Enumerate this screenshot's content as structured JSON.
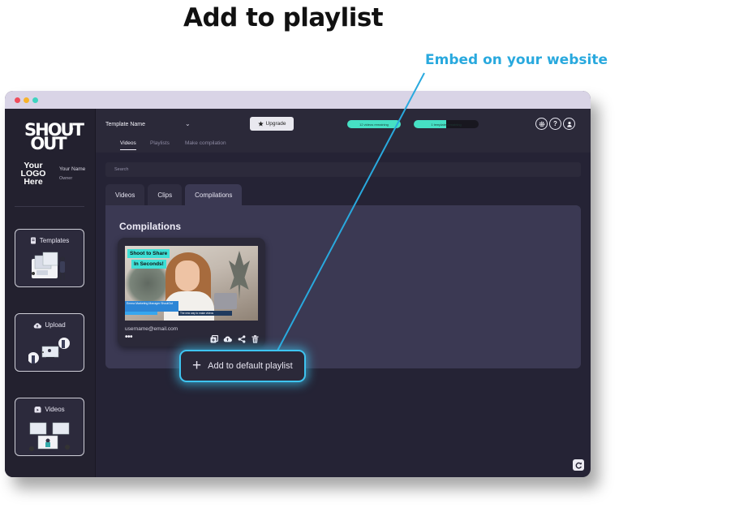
{
  "heading": "Add to playlist",
  "callout": {
    "label": "Embed on your website",
    "color": "#29a9de"
  },
  "window": {
    "dot_colors": [
      "#ef4d5c",
      "#f7b32b",
      "#3fd4c0"
    ]
  },
  "sidebar": {
    "logo_line1": "SHOUT",
    "logo_line2": "OUT",
    "logo_reg": "®",
    "your_logo_lines": [
      "Your",
      "LOGO",
      "Here"
    ],
    "user_name": "Your Name",
    "user_role": "Owner",
    "cards": [
      {
        "label": "Templates",
        "icon": "template-icon"
      },
      {
        "label": "Upload",
        "icon": "cloud-upload-icon"
      },
      {
        "label": "Videos",
        "icon": "video-icon"
      }
    ]
  },
  "topbar": {
    "template_name": "Template Name",
    "template_caret": "⌄",
    "upgrade_label": "Upgrade",
    "pill_videos": "12 videos remaining",
    "pill_templates": "1 template remaining",
    "pill_templates_fill_fraction": 0.5,
    "icons": [
      "gear-icon",
      "help-icon",
      "user-icon"
    ],
    "subtabs": [
      "Videos",
      "Playlists",
      "Make compilation"
    ],
    "active_subtab": "Videos"
  },
  "search": {
    "placeholder": "Search"
  },
  "tabs": {
    "items": [
      "Videos",
      "Clips",
      "Compilations"
    ],
    "active": "Compilations"
  },
  "panel": {
    "title": "Compilations",
    "card": {
      "caption_line1": "Shoot to Share",
      "caption_line2": "In Seconds!",
      "lower_third": "Emma Marketing Manager ShoutOut",
      "strip_text": "The new way to make videos",
      "email": "username@email.com",
      "more": "•••",
      "actions": [
        "playlist-add-icon",
        "cloud-upload-icon",
        "share-icon",
        "trash-icon"
      ]
    }
  },
  "tooltip": {
    "label": "Add to default playlist",
    "plus": "+"
  }
}
